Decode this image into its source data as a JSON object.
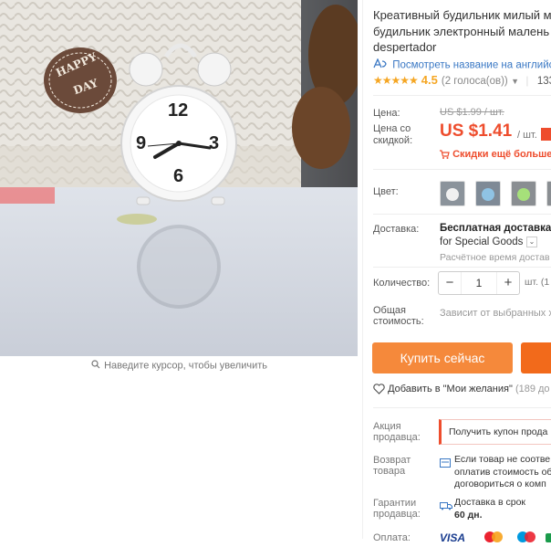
{
  "image": {
    "zoom_hint": "Наведите курсор, чтобы увеличить",
    "badge_text_1": "HAPPY",
    "badge_text_2": "DAY",
    "clock_numbers": [
      "12",
      "3",
      "6",
      "9"
    ]
  },
  "product": {
    "title_lines": [
      "Креативный будильник милый м",
      "будильник электронный малень",
      "despertador"
    ],
    "translate_link": "Посмотреть название на английск",
    "rating": {
      "stars": "★★★★★",
      "value": "4.5",
      "votes": "(2 голоса(ов))",
      "orders": "133"
    }
  },
  "price": {
    "label": "Цена:",
    "old": "US $1.99 / шт.",
    "discount_label_1": "Цена со",
    "discount_label_2": "скидкой:",
    "new": "US $1.41",
    "unit": "/ шт.",
    "promo": "Скидки ещё больше в"
  },
  "color": {
    "label": "Цвет:"
  },
  "shipping": {
    "label": "Доставка:",
    "title": "Бесплатная доставка в",
    "subtitle": "for Special Goods",
    "time": "Расчётное время достав"
  },
  "quantity": {
    "label": "Количество:",
    "value": "1",
    "minus": "−",
    "plus": "+",
    "unit": "шт. (1"
  },
  "total": {
    "label_1": "Общая",
    "label_2": "стоимость:",
    "value": "Зависит от выбранных ха"
  },
  "actions": {
    "buy_now": "Купить сейчас",
    "wishlist": "Добавить в \"Мои желания\"",
    "wishlist_count": "(189 до"
  },
  "seller_promo": {
    "label_1": "Акция",
    "label_2": "продавца:",
    "coupon": "Получить купон прода"
  },
  "returns": {
    "label_1": "Возврат",
    "label_2": "товара",
    "lines": [
      "Если товар не соотве",
      "оплатив стоимость об",
      "договориться о комп"
    ]
  },
  "guarantee": {
    "label_1": "Гарантии",
    "label_2": "продавца:",
    "line1": "Доставка в срок",
    "line2": "60 дн."
  },
  "payment": {
    "label": "Оплата:",
    "visa": "VISA"
  },
  "colors": {
    "accent": "#ee4d2d",
    "buy_button": "#f5893b",
    "cart_button": "#f26a1b",
    "link": "#3a78c4",
    "star": "#f5a623"
  }
}
